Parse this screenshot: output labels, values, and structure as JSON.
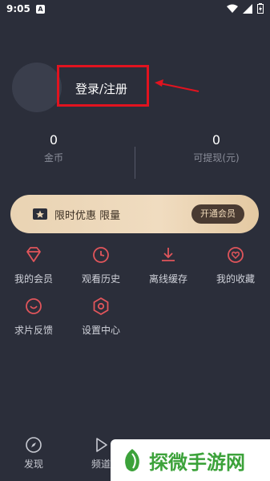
{
  "status_bar": {
    "time": "9:05",
    "app_glyph": "A",
    "icons": [
      "wifi-icon",
      "signal-icon",
      "battery-icon"
    ]
  },
  "profile": {
    "login_label": "登录/注册"
  },
  "stats": [
    {
      "value": "0",
      "label": "金币"
    },
    {
      "value": "0",
      "label": "可提现(元)"
    }
  ],
  "vip": {
    "text": "限时优惠 限量",
    "button_label": "开通会员"
  },
  "menu": [
    {
      "label": "我的会员",
      "icon": "diamond-icon"
    },
    {
      "label": "观看历史",
      "icon": "clock-icon"
    },
    {
      "label": "离线缓存",
      "icon": "download-icon"
    },
    {
      "label": "我的收藏",
      "icon": "heart-icon"
    },
    {
      "label": "求片反馈",
      "icon": "feedback-icon"
    },
    {
      "label": "设置中心",
      "icon": "settings-icon"
    }
  ],
  "bottom_nav": [
    {
      "label": "发现",
      "icon": "compass-icon"
    },
    {
      "label": "频道",
      "icon": "play-icon"
    }
  ],
  "watermark": {
    "text": "探微手游网"
  },
  "colors": {
    "background": "#2b2e3a",
    "accent": "#e0555b",
    "highlight": "#e1131f",
    "vip_gold": "#e9d3b3"
  }
}
